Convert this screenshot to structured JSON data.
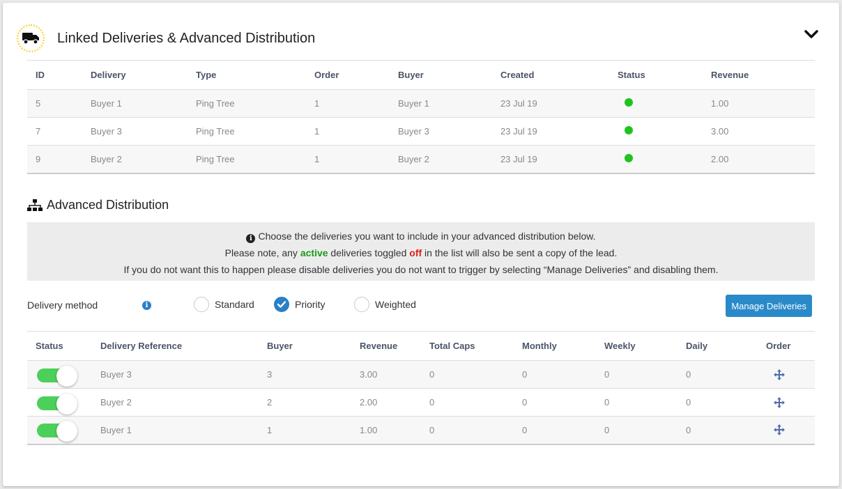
{
  "header": {
    "title": "Linked Deliveries & Advanced Distribution"
  },
  "linked": {
    "columns": [
      "ID",
      "Delivery",
      "Type",
      "Order",
      "Buyer",
      "Created",
      "Status",
      "Revenue"
    ],
    "rows": [
      {
        "id": "5",
        "delivery": "Buyer 1",
        "type": "Ping Tree",
        "order": "1",
        "buyer": "Buyer 1",
        "created": "23 Jul 19",
        "revenue": "1.00"
      },
      {
        "id": "7",
        "delivery": "Buyer 3",
        "type": "Ping Tree",
        "order": "1",
        "buyer": "Buyer 3",
        "created": "23 Jul 19",
        "revenue": "3.00"
      },
      {
        "id": "9",
        "delivery": "Buyer 2",
        "type": "Ping Tree",
        "order": "1",
        "buyer": "Buyer 2",
        "created": "23 Jul 19",
        "revenue": "2.00"
      }
    ]
  },
  "advanced": {
    "title": "Advanced Distribution",
    "info": {
      "line1": "Choose the deliveries you want to include in your advanced distribution below.",
      "line2_a": "Please note, any ",
      "line2_active": "active",
      "line2_b": " deliveries toggled ",
      "line2_off": "off",
      "line2_c": " in the list will also be sent a copy of the lead.",
      "line3": "If you do not want this to happen please disable deliveries you do not want to trigger by selecting “Manage Deliveries” and disabling them."
    },
    "method_label": "Delivery method",
    "methods": [
      "Standard",
      "Priority",
      "Weighted"
    ],
    "selected_method": "Priority",
    "manage_button": "Manage Deliveries",
    "columns": [
      "Status",
      "Delivery Reference",
      "Buyer",
      "Revenue",
      "Total Caps",
      "Monthly",
      "Weekly",
      "Daily",
      "Order"
    ],
    "rows": [
      {
        "reference": "Buyer 3",
        "buyer": "3",
        "revenue": "3.00",
        "total_caps": "0",
        "monthly": "0",
        "weekly": "0",
        "daily": "0"
      },
      {
        "reference": "Buyer 2",
        "buyer": "2",
        "revenue": "2.00",
        "total_caps": "0",
        "monthly": "0",
        "weekly": "0",
        "daily": "0"
      },
      {
        "reference": "Buyer 1",
        "buyer": "1",
        "revenue": "1.00",
        "total_caps": "0",
        "monthly": "0",
        "weekly": "0",
        "daily": "0"
      }
    ]
  },
  "colors": {
    "accent": "#2a8ac9",
    "status_green": "#1ec41e",
    "toggle_green": "#4cd05a",
    "badge_border": "#f4d21c"
  }
}
